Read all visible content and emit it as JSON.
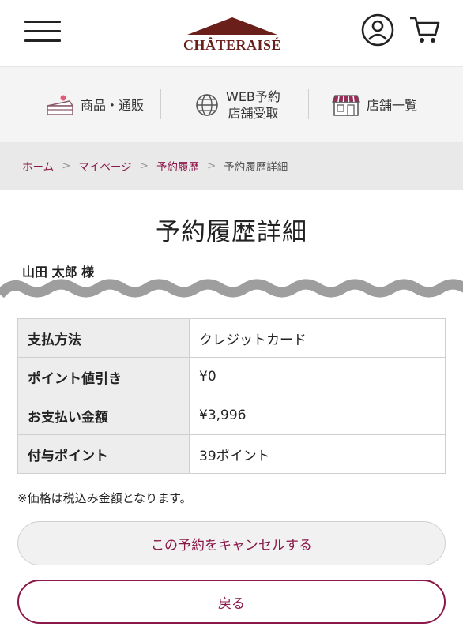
{
  "header": {
    "logo_text": "CHÂTERAISÉ",
    "menu_icon": "hamburger-menu-icon",
    "user_icon": "user-account-icon",
    "cart_icon": "shopping-cart-icon"
  },
  "nav": {
    "items": [
      {
        "label": "商品・通販",
        "icon": "cake-icon"
      },
      {
        "label_line1": "WEB予約",
        "label_line2": "店舗受取",
        "icon": "globe-icon"
      },
      {
        "label": "店舗一覧",
        "icon": "store-icon"
      }
    ]
  },
  "breadcrumb": {
    "items": [
      "ホーム",
      "マイページ",
      "予約履歴"
    ],
    "separator": ">",
    "current": "予約履歴詳細"
  },
  "page": {
    "title": "予約履歴詳細",
    "username": "山田 太郎 様"
  },
  "summary": {
    "rows": [
      {
        "label": "支払方法",
        "value": "クレジットカード"
      },
      {
        "label": "ポイント値引き",
        "value": "¥0"
      },
      {
        "label": "お支払い金額",
        "value": "¥3,996"
      },
      {
        "label": "付与ポイント",
        "value": "39ポイント"
      }
    ]
  },
  "note": "※価格は税込み金額となります。",
  "buttons": {
    "cancel": "この予約をキャンセルする",
    "back": "戻る"
  },
  "colors": {
    "accent": "#8a1848",
    "logo": "#6b1f1a"
  }
}
